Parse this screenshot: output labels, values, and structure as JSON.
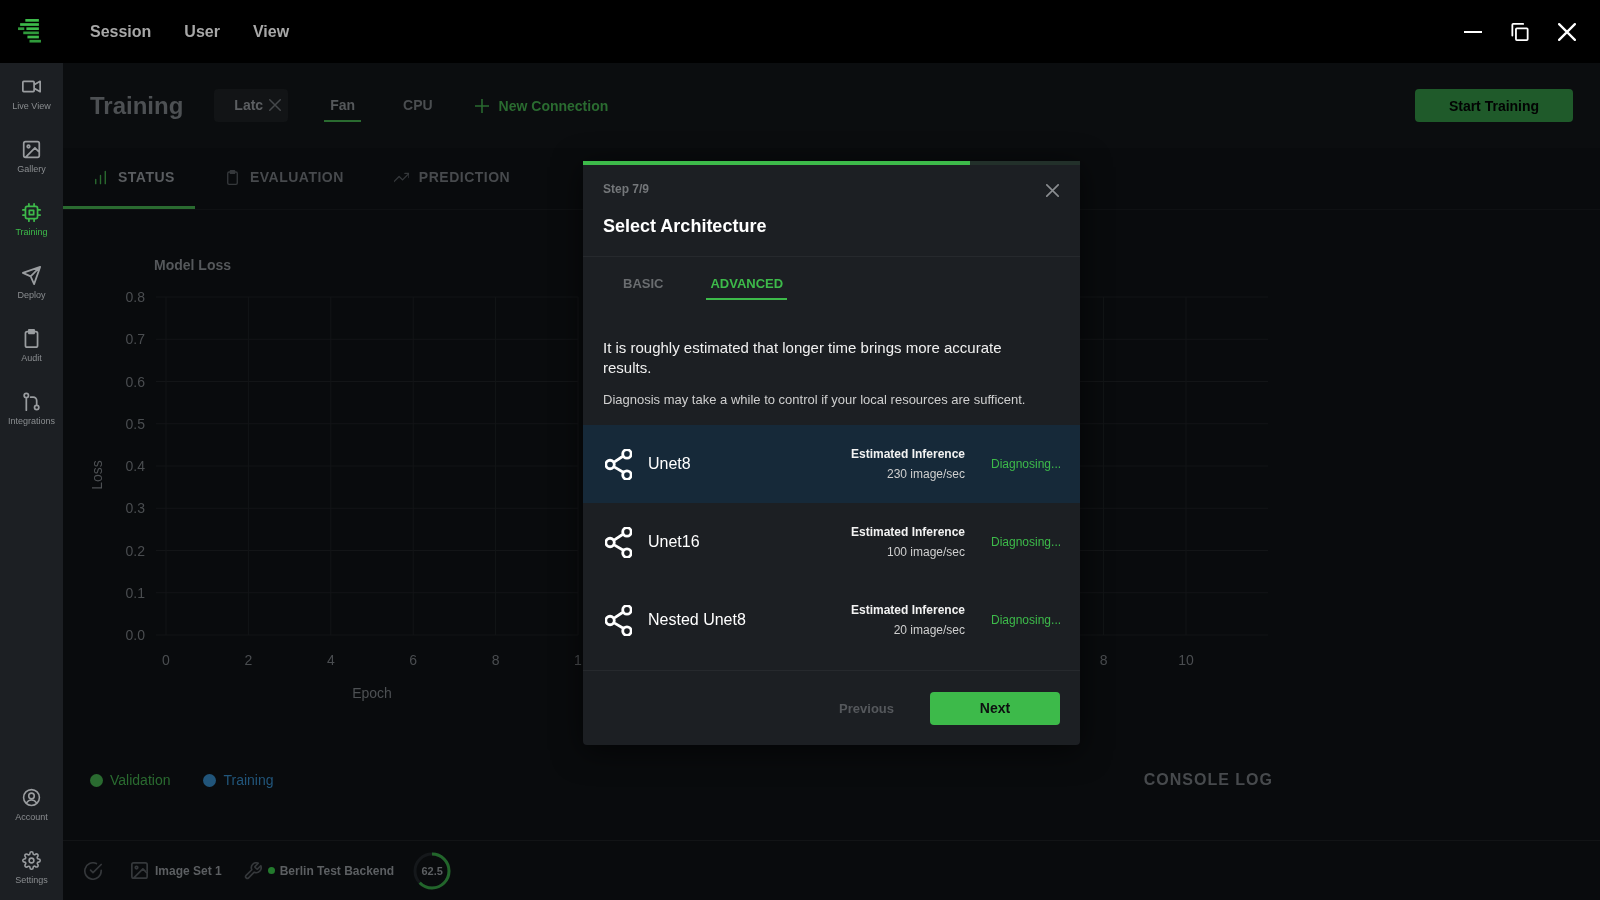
{
  "menu": [
    "Session",
    "User",
    "View"
  ],
  "sidebar": {
    "top": [
      {
        "label": "Live View",
        "selected": false
      },
      {
        "label": "Gallery",
        "selected": false
      },
      {
        "label": "Training",
        "selected": true
      },
      {
        "label": "Deploy",
        "selected": false
      },
      {
        "label": "Audit",
        "selected": false
      },
      {
        "label": "Integrations",
        "selected": false
      }
    ],
    "bottom": [
      {
        "label": "Account",
        "selected": false
      },
      {
        "label": "Settings",
        "selected": false
      }
    ]
  },
  "header": {
    "title": "Training",
    "connections": [
      {
        "label": "Latc",
        "kind": "closable",
        "selected": false
      },
      {
        "label": "Fan",
        "kind": "tab",
        "selected": true
      },
      {
        "label": "CPU",
        "kind": "tab",
        "selected": false
      }
    ],
    "new_connection": "New Connection",
    "start_button": "Start Training"
  },
  "section_tabs": [
    {
      "label": "STATUS",
      "selected": true
    },
    {
      "label": "EVALUATION",
      "selected": false
    },
    {
      "label": "PREDICTION",
      "selected": false
    }
  ],
  "charts": [
    {
      "chart_data": {
        "type": "line",
        "title": "Model Loss",
        "xlabel": "Epoch",
        "ylabel": "Loss",
        "xlim": [
          0,
          10
        ],
        "ylim": [
          0,
          0.8
        ],
        "xticks": [
          0,
          2,
          4,
          6,
          8
        ],
        "yticks": [
          {
            "value": 0,
            "label": "0.0"
          },
          0.1,
          0.2,
          0.3,
          0.4,
          0.5,
          0.6,
          0.7,
          0.8
        ],
        "grid": true
      },
      "covered_tick_label": "1"
    }
  ],
  "covered_chart": {
    "x_tick_labels": [
      "8",
      "10"
    ]
  },
  "legend": [
    {
      "label": "Validation",
      "color": "#2a6b30"
    },
    {
      "label": "Training",
      "color": "#21557a"
    }
  ],
  "console_log": "CONSOLE LOG",
  "status_bar": {
    "dataset": "Image Set 1",
    "backend": {
      "label": "Berlin Test Backend",
      "connected": true
    },
    "progress": {
      "label": "62.5",
      "level": 0.625
    }
  },
  "modal": {
    "progress": {
      "level": 0.778
    },
    "step": "Step 7/9",
    "title": "Select Architecture",
    "tabs": [
      {
        "label": "BASIC",
        "selected": false
      },
      {
        "label": "ADVANCED",
        "selected": true
      }
    ],
    "lead": "It is roughly estimated that longer time brings more accurate results.",
    "note": "Diagnosis may take a while to control if your local resources are sufficent.",
    "architectures": [
      {
        "name": "Unet8",
        "metric_label": "Estimated Inference",
        "metric_value": "230 image/sec",
        "status": "Diagnosing...",
        "selected": true
      },
      {
        "name": "Unet16",
        "metric_label": "Estimated Inference",
        "metric_value": "100 image/sec",
        "status": "Diagnosing...",
        "selected": false
      },
      {
        "name": "Nested Unet8",
        "metric_label": "Estimated Inference",
        "metric_value": "20 image/sec",
        "status": "Diagnosing...",
        "selected": false
      }
    ],
    "buttons": [
      {
        "label": "Previous",
        "kind": "text",
        "disabled": true
      },
      {
        "label": "Next",
        "kind": "primary",
        "disabled": false
      }
    ]
  }
}
